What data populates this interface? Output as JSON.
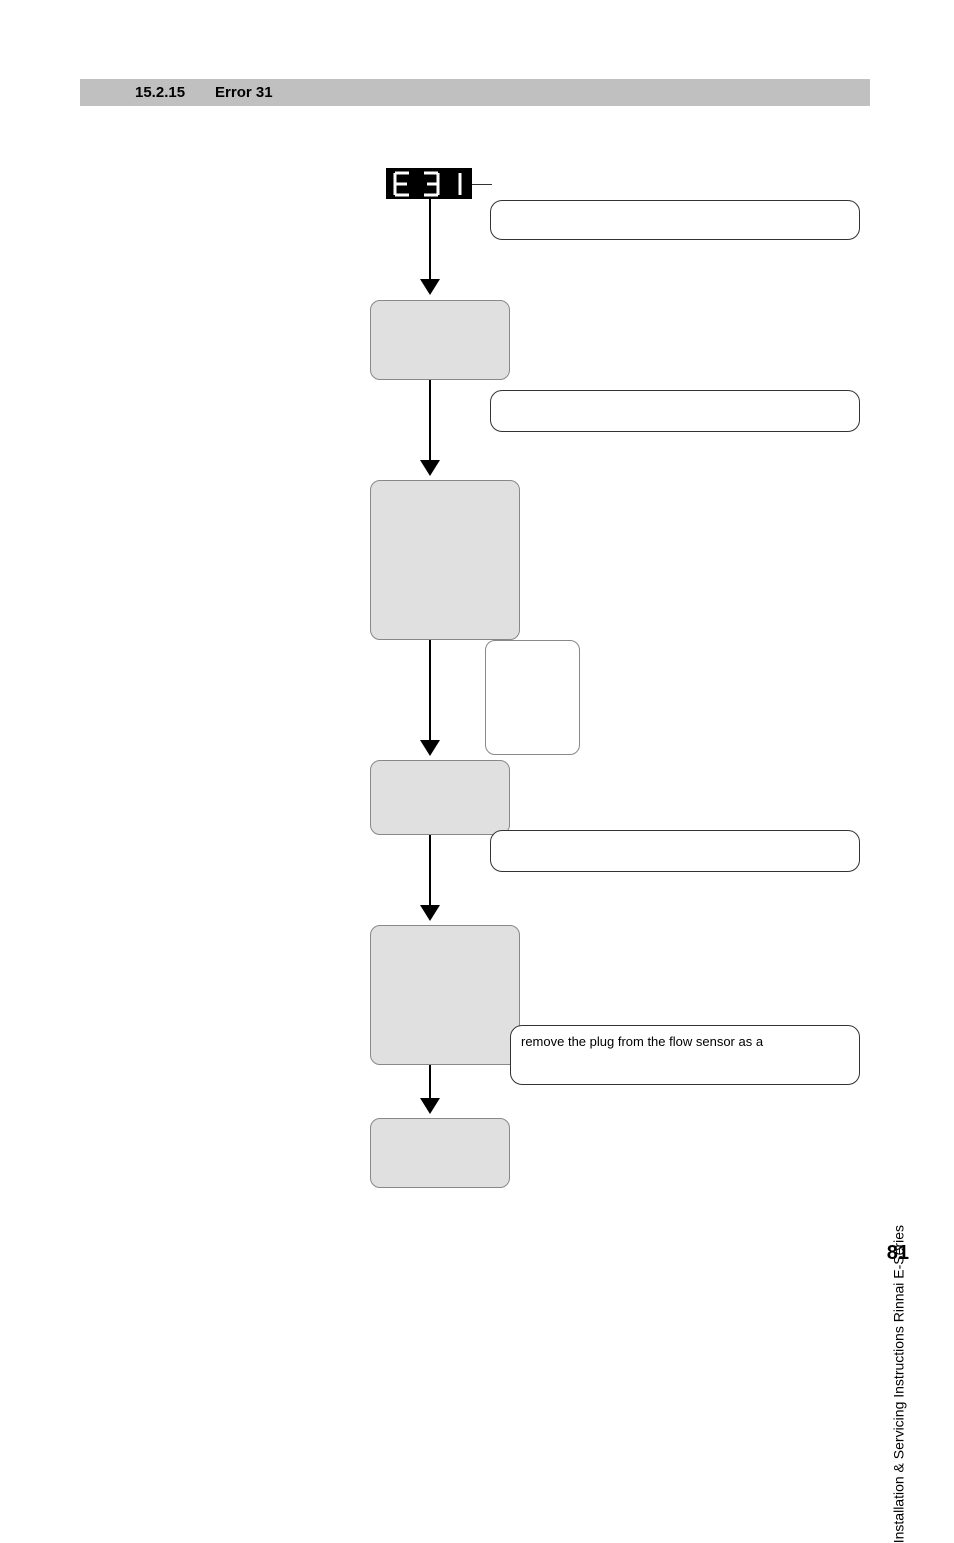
{
  "header": {
    "number": "15.2.15",
    "title": "Error 31"
  },
  "lcd": {
    "chars": [
      "E",
      "3",
      "1"
    ]
  },
  "callouts": {
    "c1": "",
    "c2": "",
    "c3": "",
    "c4": "",
    "c5": "remove the plug from the flow sensor as a"
  },
  "side_text": "Installation & Servicing Instructions Rinnai E-Series",
  "page_number": "81",
  "chart_data": {
    "type": "flowchart",
    "nodes": [
      {
        "id": "lcd",
        "label": "E 31",
        "kind": "display"
      },
      {
        "id": "g1",
        "kind": "process",
        "label": ""
      },
      {
        "id": "g2",
        "kind": "process",
        "label": ""
      },
      {
        "id": "w1",
        "kind": "note",
        "label": ""
      },
      {
        "id": "g3",
        "kind": "process",
        "label": ""
      },
      {
        "id": "g4",
        "kind": "process",
        "label": ""
      },
      {
        "id": "g5",
        "kind": "process",
        "label": ""
      }
    ],
    "edges": [
      [
        "lcd",
        "g1"
      ],
      [
        "g1",
        "g2"
      ],
      [
        "g2",
        "g3"
      ],
      [
        "g3",
        "g4"
      ],
      [
        "g4",
        "g5"
      ]
    ],
    "callouts": [
      {
        "attached_to": "lcd",
        "text": ""
      },
      {
        "attached_to": "g1",
        "text": ""
      },
      {
        "attached_to": "g2",
        "text": ""
      },
      {
        "attached_to": "g3",
        "text": ""
      },
      {
        "attached_to": "g4",
        "text": "remove the plug from the flow sensor as a"
      }
    ]
  }
}
